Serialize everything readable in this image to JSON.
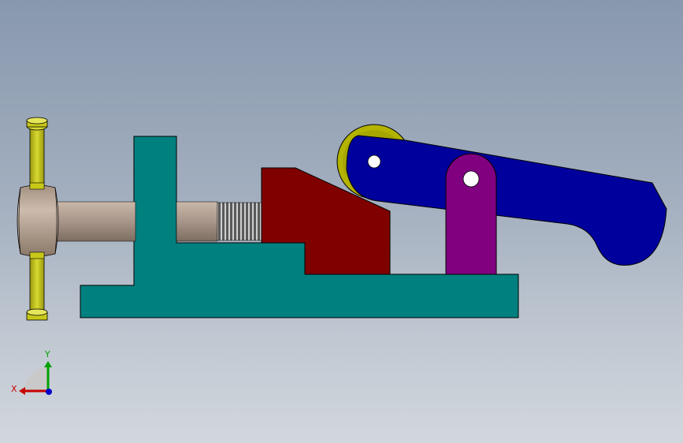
{
  "viewport": {
    "background_top": "#8898ae",
    "background_bottom": "#d2d7dd"
  },
  "colors": {
    "base_block": "#00807f",
    "wedge_block": "#800000",
    "lever_arm": "#00009c",
    "roller": "#b3b300",
    "support_link": "#800080",
    "handle_bar": "#c8c819",
    "screw_hub": "#bca99a",
    "screw_shaft": "#a8968a",
    "thread": "#6e6e6e",
    "outline": "#000000",
    "axis_x": "#c80000",
    "axis_y": "#00a000",
    "axis_z": "#0000c8"
  },
  "icons": {
    "triad": "coordinate-triad-icon"
  },
  "triad": {
    "x_label": "X",
    "y_label": "Y"
  }
}
